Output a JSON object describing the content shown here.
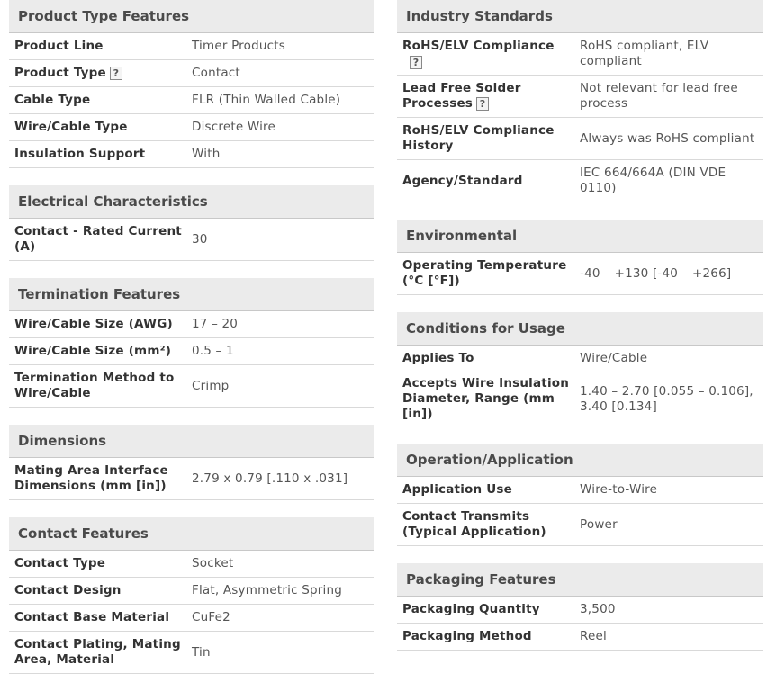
{
  "left": [
    {
      "title": "Product Type Features",
      "rows": [
        {
          "label": "Product Line",
          "value": "Timer Products"
        },
        {
          "label": "Product Type",
          "value": "Contact",
          "help": "?"
        },
        {
          "label": "Cable Type",
          "value": "FLR (Thin Walled Cable)"
        },
        {
          "label": "Wire/Cable Type",
          "value": "Discrete Wire"
        },
        {
          "label": "Insulation Support",
          "value": "With"
        }
      ]
    },
    {
      "title": "Electrical Characteristics",
      "rows": [
        {
          "label": "Contact - Rated Current (A)",
          "value": "30"
        }
      ]
    },
    {
      "title": "Termination Features",
      "rows": [
        {
          "label": "Wire/Cable Size (AWG)",
          "value": "17 – 20"
        },
        {
          "label": "Wire/Cable Size (mm²)",
          "value": "0.5 – 1"
        },
        {
          "label": "Termination Method to Wire/Cable",
          "value": "Crimp"
        }
      ]
    },
    {
      "title": "Dimensions",
      "rows": [
        {
          "label": "Mating Area Interface Dimensions (mm [in])",
          "value": "2.79 x 0.79 [.110 x .031]"
        }
      ]
    },
    {
      "title": "Contact Features",
      "rows": [
        {
          "label": "Contact Type",
          "value": "Socket"
        },
        {
          "label": "Contact Design",
          "value": "Flat, Asymmetric Spring"
        },
        {
          "label": "Contact Base Material",
          "value": "CuFe2"
        },
        {
          "label": "Contact Plating, Mating Area, Material",
          "value": "Tin"
        }
      ]
    }
  ],
  "right": [
    {
      "title": "Industry Standards",
      "rows": [
        {
          "label": "RoHS/ELV Compliance",
          "value": "RoHS compliant, ELV compliant",
          "help": "?"
        },
        {
          "label": "Lead Free Solder Processes",
          "value": "Not relevant for lead free process",
          "help": "?"
        },
        {
          "label": "RoHS/ELV Compliance History",
          "value": "Always was RoHS compliant"
        },
        {
          "label": "Agency/Standard",
          "value": "IEC 664/664A (DIN VDE 0110)"
        }
      ]
    },
    {
      "title": "Environmental",
      "rows": [
        {
          "label": "Operating Temperature (°C [°F])",
          "value": "-40 – +130 [-40 – +266]"
        }
      ]
    },
    {
      "title": "Conditions for Usage",
      "rows": [
        {
          "label": "Applies To",
          "value": "Wire/Cable"
        },
        {
          "label": "Accepts Wire Insulation Diameter, Range (mm [in])",
          "value": "1.40 – 2.70 [0.055 – 0.106], 3.40 [0.134]"
        }
      ]
    },
    {
      "title": "Operation/Application",
      "rows": [
        {
          "label": "Application Use",
          "value": "Wire-to-Wire"
        },
        {
          "label": "Contact Transmits (Typical Application)",
          "value": "Power"
        }
      ]
    },
    {
      "title": "Packaging Features",
      "rows": [
        {
          "label": "Packaging Quantity",
          "value": "3,500"
        },
        {
          "label": "Packaging Method",
          "value": "Reel"
        }
      ]
    }
  ]
}
